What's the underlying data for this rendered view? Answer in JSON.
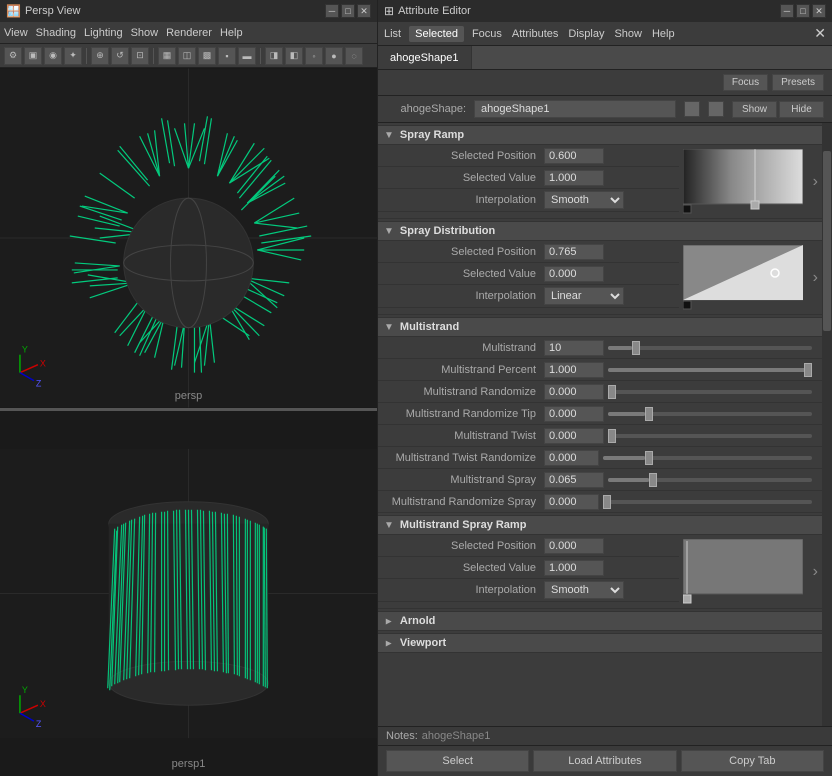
{
  "leftPanel": {
    "title": "Persp View",
    "menus": [
      "View",
      "Shading",
      "Lighting",
      "Show",
      "Renderer",
      "Help"
    ],
    "viewport1": {
      "label": "persp"
    },
    "viewport2": {
      "label": "persp1"
    }
  },
  "rightPanel": {
    "title": "Attribute Editor",
    "menus": [
      "List",
      "Selected",
      "Focus",
      "Attributes",
      "Display",
      "Show",
      "Help"
    ],
    "activeTab": "ahogeShape1",
    "nodeName": "ahogeShape1",
    "nodeLabel": "ahogeShape:",
    "focusBtn": "Focus",
    "presetsBtn": "Presets",
    "showBtn": "Show",
    "hideBtn": "Hide",
    "sprayRamp": {
      "sectionTitle": "Spray Ramp",
      "selectedPosition": {
        "label": "Selected Position",
        "value": "0.600"
      },
      "selectedValue": {
        "label": "Selected Value",
        "value": "1.000"
      },
      "interpolation": {
        "label": "Interpolation",
        "value": "Smooth"
      }
    },
    "sprayDistribution": {
      "sectionTitle": "Spray Distribution",
      "selectedPosition": {
        "label": "Selected Position",
        "value": "0.765"
      },
      "selectedValue": {
        "label": "Selected Value",
        "value": "0.000"
      },
      "interpolation": {
        "label": "Interpolation",
        "value": "Linear"
      }
    },
    "multistrand": {
      "sectionTitle": "Multistrand",
      "fields": [
        {
          "label": "Multistrand",
          "value": "10",
          "sliderPct": 12
        },
        {
          "label": "Multistrand Percent",
          "value": "1.000",
          "sliderPct": 100
        },
        {
          "label": "Multistrand Randomize",
          "value": "0.000",
          "sliderPct": 0
        },
        {
          "label": "Multistrand Randomize Tip",
          "value": "0.000",
          "sliderPct": 18
        },
        {
          "label": "Multistrand Twist",
          "value": "0.000",
          "sliderPct": 0
        },
        {
          "label": "Multistrand Twist Randomize",
          "value": "0.000",
          "sliderPct": 20
        },
        {
          "label": "Multistrand Spray",
          "value": "0.065",
          "sliderPct": 20
        },
        {
          "label": "Multistrand Randomize Spray",
          "value": "0.000",
          "sliderPct": 0
        }
      ]
    },
    "multistrandSprayRamp": {
      "sectionTitle": "Multistrand Spray Ramp",
      "selectedPosition": {
        "label": "Selected Position",
        "value": "0.000"
      },
      "selectedValue": {
        "label": "Selected Value",
        "value": "1.000"
      },
      "interpolation": {
        "label": "Interpolation",
        "value": "Smooth"
      }
    },
    "arnold": {
      "sectionTitle": "Arnold",
      "collapsed": true
    },
    "viewport": {
      "sectionTitle": "Viewport",
      "collapsed": true
    },
    "notes": "ahogeShape1",
    "notesLabel": "Notes:",
    "bottomBtns": {
      "select": "Select",
      "loadAttributes": "Load Attributes",
      "copyTab": "Copy Tab"
    }
  }
}
